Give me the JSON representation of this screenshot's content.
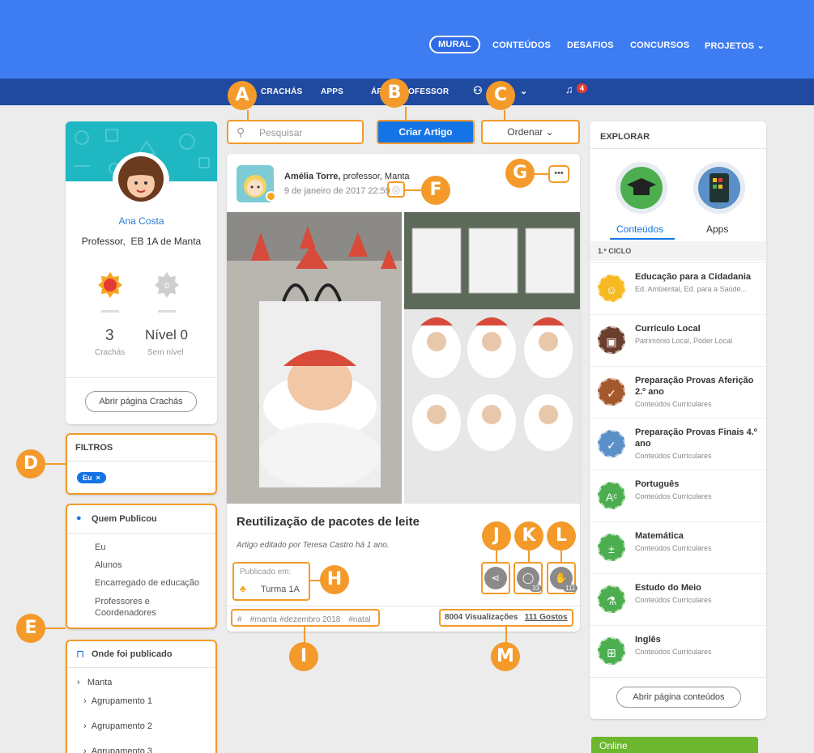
{
  "topnav": [
    "MURAL",
    "CONTEÚDOS",
    "DESAFIOS",
    "CONCURSOS",
    "PROJETOS"
  ],
  "subnav": {
    "items": [
      "CRACHÁS",
      "APPS",
      "ÁREA PROFESSOR"
    ],
    "notif_count": "4"
  },
  "markers": [
    "A",
    "B",
    "C",
    "D",
    "E",
    "F",
    "G",
    "H",
    "I",
    "J",
    "K",
    "L",
    "M"
  ],
  "profile": {
    "name": "Ana Costa",
    "role": "Professor,",
    "school": "EB 1A de Manta",
    "badges_count": "3",
    "badges_label": "Crachás",
    "level": "Nível 0",
    "level_label": "Sem nível",
    "open_badges_button": "Abrir página Crachás"
  },
  "filters": {
    "title": "FILTROS",
    "chip": "Eu",
    "chip_close": "×"
  },
  "who_published": {
    "title": "Quem Publicou",
    "items": [
      "Eu",
      "Alunos",
      "Encarregado de educação",
      "Professores e Coordenadores"
    ]
  },
  "where_published": {
    "title": "Onde foi publicado",
    "items": [
      "Manta",
      "Agrupamento 1",
      "Agrupamento 2",
      "Agrupamento 3"
    ]
  },
  "search": {
    "placeholder": "Pesquisar"
  },
  "create_button": "Criar Artigo",
  "order_button": "Ordenar",
  "post": {
    "author": "Amélia Torre,",
    "author_meta": "professor, Manta",
    "date": "9 de janeiro de 2017 22:59",
    "more": "•••",
    "title": "Reutilização de pacotes de leite",
    "edited": "Artigo editado por Teresa Castro há 1 ano.",
    "published_label": "Publicado em:",
    "published_in": "Turma 1A",
    "tags": [
      "#",
      "#manta",
      "#dezembro 2018",
      "#natal"
    ],
    "comments_count": "33",
    "likes_count": "111",
    "views": "8004 Visualizações",
    "likes": "111 Gostos"
  },
  "explorar": {
    "title": "EXPLORAR",
    "tabs": [
      "Conteúdos",
      "Apps"
    ],
    "section": "1.º CICLO",
    "items": [
      {
        "title": "Educação para a Cidadania",
        "sub": "Ed. Ambiental, Ed. para a Saúde...",
        "color": "#f5b921"
      },
      {
        "title": "Currículo Local",
        "sub": "Património Local, Poder Local",
        "color": "#6b3d2e"
      },
      {
        "title": "Preparação Provas Aferição 2.º ano",
        "sub": "Conteúdos Curriculares",
        "color": "#a4592c"
      },
      {
        "title": "Preparação Provas Finais 4.º ano",
        "sub": "Conteúdos Curriculares",
        "color": "#5b8fc7"
      },
      {
        "title": "Português",
        "sub": "Conteúdos Curriculares",
        "color": "#4cae4f"
      },
      {
        "title": "Matemática",
        "sub": "Conteúdos Curriculares",
        "color": "#4cae4f"
      },
      {
        "title": "Estudo do Meio",
        "sub": "Conteúdos Curriculares",
        "color": "#4cae4f"
      },
      {
        "title": "Inglês",
        "sub": "Conteúdos Curriculares",
        "color": "#4cae4f"
      }
    ],
    "open_button": "Abrir página conteúdos"
  },
  "online": "Online"
}
